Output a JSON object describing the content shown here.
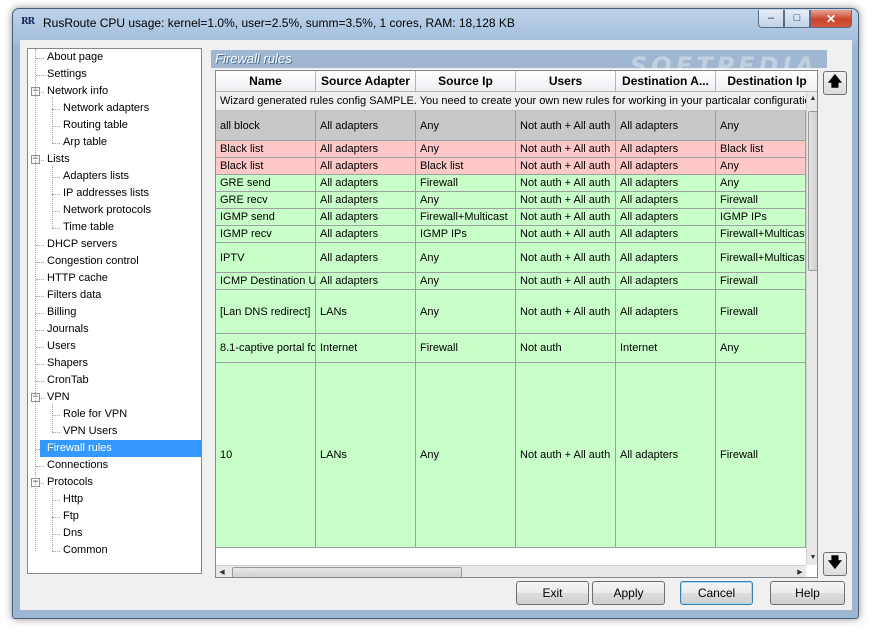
{
  "window": {
    "icon_text": "RR",
    "title": "RusRoute   CPU usage: kernel=1.0%, user=2.5%, summ=3.5%, 1 cores,   RAM: 18,128 KB",
    "watermark": "SOFTPEDIA",
    "minimize": "–",
    "maximize": "□",
    "close": "✕"
  },
  "tree": {
    "items": [
      {
        "label": "About page",
        "level": 0,
        "expander": ""
      },
      {
        "label": "Settings",
        "level": 0,
        "expander": ""
      },
      {
        "label": "Network info",
        "level": 0,
        "expander": "−"
      },
      {
        "label": "Network adapters",
        "level": 1,
        "expander": ""
      },
      {
        "label": "Routing table",
        "level": 1,
        "expander": ""
      },
      {
        "label": "Arp table",
        "level": 1,
        "expander": ""
      },
      {
        "label": "Lists",
        "level": 0,
        "expander": "−"
      },
      {
        "label": "Adapters lists",
        "level": 1,
        "expander": ""
      },
      {
        "label": "IP addresses lists",
        "level": 1,
        "expander": ""
      },
      {
        "label": "Network protocols",
        "level": 1,
        "expander": ""
      },
      {
        "label": "Time table",
        "level": 1,
        "expander": ""
      },
      {
        "label": "DHCP servers",
        "level": 0,
        "expander": ""
      },
      {
        "label": "Congestion control",
        "level": 0,
        "expander": ""
      },
      {
        "label": "HTTP cache",
        "level": 0,
        "expander": ""
      },
      {
        "label": "Filters data",
        "level": 0,
        "expander": ""
      },
      {
        "label": "Billing",
        "level": 0,
        "expander": ""
      },
      {
        "label": "Journals",
        "level": 0,
        "expander": ""
      },
      {
        "label": "Users",
        "level": 0,
        "expander": ""
      },
      {
        "label": "Shapers",
        "level": 0,
        "expander": ""
      },
      {
        "label": "CronTab",
        "level": 0,
        "expander": ""
      },
      {
        "label": "VPN",
        "level": 0,
        "expander": "−"
      },
      {
        "label": "Role for VPN",
        "level": 1,
        "expander": ""
      },
      {
        "label": "VPN Users",
        "level": 1,
        "expander": ""
      },
      {
        "label": "Firewall rules",
        "level": 0,
        "expander": "",
        "selected": true
      },
      {
        "label": "Connections",
        "level": 0,
        "expander": ""
      },
      {
        "label": "Protocols",
        "level": 0,
        "expander": "−"
      },
      {
        "label": "Http",
        "level": 1,
        "expander": ""
      },
      {
        "label": "Ftp",
        "level": 1,
        "expander": ""
      },
      {
        "label": "Dns",
        "level": 1,
        "expander": ""
      },
      {
        "label": "Common",
        "level": 1,
        "expander": ""
      }
    ]
  },
  "panel": {
    "title": "Firewall rules",
    "columns": [
      "Name",
      "Source Adapter",
      "Source Ip",
      "Users",
      "Destination A...",
      "Destination Ip"
    ],
    "notice": "Wizard generated rules config SAMPLE. You need to create your own new rules for working in your particalar configuration p",
    "rows": [
      {
        "cells": [
          "all block",
          "All adapters",
          "Any",
          "Not auth + All auth",
          "All adapters",
          "Any"
        ],
        "color": "#c8c8c8"
      },
      {
        "cells": [
          "Black list",
          "All adapters",
          "Any",
          "Not auth + All auth",
          "All adapters",
          "Black list"
        ],
        "color": "#ffc8c8"
      },
      {
        "cells": [
          "Black list",
          "All adapters",
          "Black list",
          "Not auth + All auth",
          "All adapters",
          "Any"
        ],
        "color": "#ffc8c8"
      },
      {
        "cells": [
          "GRE send",
          "All adapters",
          "Firewall",
          "Not auth + All auth",
          "All adapters",
          "Any"
        ],
        "color": "#c8ffc8"
      },
      {
        "cells": [
          "GRE recv",
          "All adapters",
          "Any",
          "Not auth + All auth",
          "All adapters",
          "Firewall"
        ],
        "color": "#c8ffc8"
      },
      {
        "cells": [
          "IGMP send",
          "All adapters",
          "Firewall+Multicast",
          "Not auth + All auth",
          "All adapters",
          "IGMP IPs"
        ],
        "color": "#c8ffc8"
      },
      {
        "cells": [
          "IGMP recv",
          "All adapters",
          "IGMP IPs",
          "Not auth + All auth",
          "All adapters",
          "Firewall+Multicast"
        ],
        "color": "#c8ffc8"
      },
      {
        "cells": [
          "IPTV",
          "All adapters",
          "Any",
          "Not auth + All auth",
          "All adapters",
          "Firewall+Multicast"
        ],
        "color": "#c8ffc8"
      },
      {
        "cells": [
          "ICMP Destination U",
          "All adapters",
          "Any",
          "Not auth + All auth",
          "All adapters",
          "Firewall"
        ],
        "color": "#c8ffc8"
      },
      {
        "cells": [
          "[Lan DNS redirect]",
          "LANs",
          "Any",
          "Not auth + All auth",
          "All adapters",
          "Firewall"
        ],
        "color": "#c8ffc8"
      },
      {
        "cells": [
          "8.1-captive portal fo",
          "Internet",
          "Firewall",
          "Not auth",
          "Internet",
          "Any"
        ],
        "color": "#c8ffc8"
      },
      {
        "cells": [
          "10",
          "LANs",
          "Any",
          "Not auth + All auth",
          "All adapters",
          "Firewall"
        ],
        "color": "#c8ffc8"
      }
    ],
    "move_up_icon": "🡅",
    "move_down_icon": "🡇"
  },
  "buttons": {
    "exit": "Exit",
    "apply": "Apply",
    "cancel": "Cancel",
    "help": "Help"
  }
}
